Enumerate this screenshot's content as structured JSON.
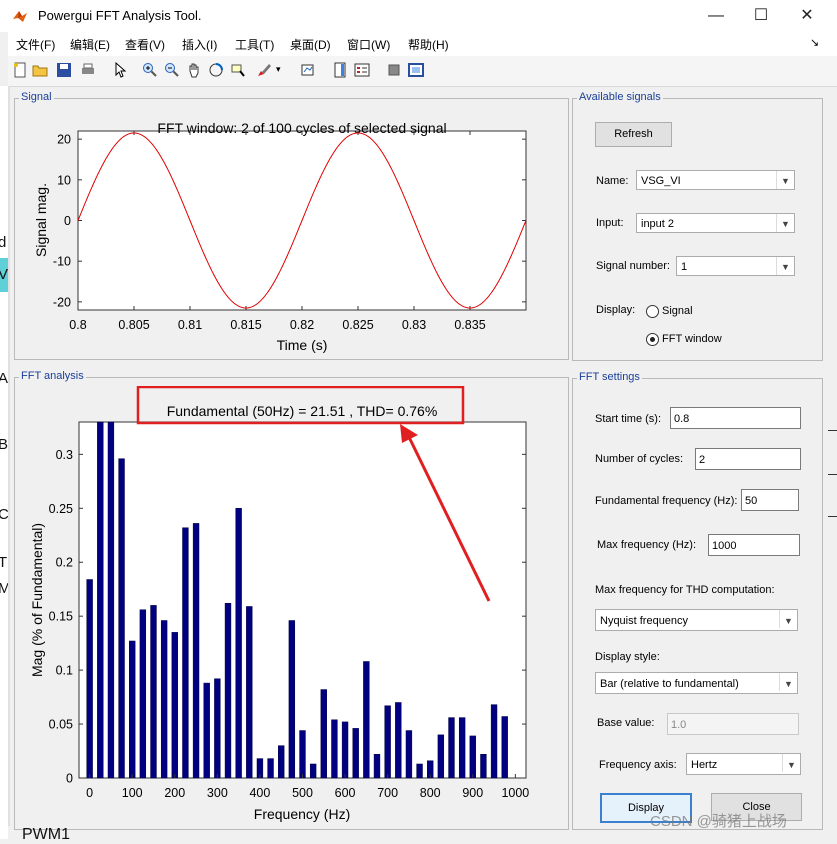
{
  "window": {
    "title": "Powergui FFT Analysis Tool."
  },
  "titlebar_buttons": {
    "minimize": "—",
    "maximize": "☐",
    "close": "✕"
  },
  "menu": [
    "文件(F)",
    "编辑(E)",
    "查看(V)",
    "插入(I)",
    "工具(T)",
    "桌面(D)",
    "窗口(W)",
    "帮助(H)"
  ],
  "signal_panel": {
    "title": "Signal",
    "plot_title": "FFT window: 2 of 100 cycles of selected signal",
    "xlabel": "Time (s)",
    "ylabel": "Signal mag.",
    "xticks": [
      "0.8",
      "0.805",
      "0.81",
      "0.815",
      "0.82",
      "0.825",
      "0.83",
      "0.835"
    ],
    "yticks": [
      "20",
      "10",
      "0",
      "-10",
      "-20"
    ]
  },
  "fft_panel": {
    "title": "FFT analysis",
    "annotation": "Fundamental (50Hz) = 21.51 , THD= 0.76%",
    "xlabel": "Frequency (Hz)",
    "ylabel": "Mag (% of Fundamental)",
    "xticks": [
      "0",
      "100",
      "200",
      "300",
      "400",
      "500",
      "600",
      "700",
      "800",
      "900",
      "1000"
    ],
    "yticks": [
      "0",
      "0.05",
      "0.1",
      "0.15",
      "0.2",
      "0.25",
      "0.3"
    ]
  },
  "available_signals": {
    "title": "Available signals",
    "refresh_label": "Refresh",
    "name_label": "Name:",
    "name_value": "VSG_VI",
    "input_label": "Input:",
    "input_value": "input 2",
    "signal_number_label": "Signal number:",
    "signal_number_value": "1",
    "display_label": "Display:",
    "display_signal": "Signal",
    "display_fft": "FFT window"
  },
  "fft_settings": {
    "title": "FFT settings",
    "start_time_label": "Start time (s):",
    "start_time": "0.8",
    "cycles_label": "Number of cycles:",
    "cycles": "2",
    "fund_freq_label": "Fundamental frequency (Hz):",
    "fund_freq": "50",
    "max_freq_label": "Max frequency (Hz):",
    "max_freq": "1000",
    "thd_label": "Max frequency for THD computation:",
    "thd_value": "Nyquist frequency",
    "display_style_label": "Display style:",
    "display_style": "Bar (relative to fundamental)",
    "base_value_label": "Base value:",
    "base_value": "1.0",
    "freq_axis_label": "Frequency axis:",
    "freq_axis": "Hertz",
    "display_button": "Display",
    "close_button": "Close"
  },
  "left_strip_chars": [
    "d",
    "V",
    "A",
    "B",
    "C",
    "T",
    "M"
  ],
  "bottom_left_text": "PWM1",
  "watermark": "CSDN @骑猪上战场",
  "colors": {
    "signal_line": "#e00000",
    "bar": "#000080",
    "annotation_box": "#e02020",
    "panel_title": "#1a3f9a"
  },
  "chart_data": [
    {
      "type": "line",
      "title": "FFT window: 2 of 100 cycles of selected signal",
      "xlabel": "Time (s)",
      "ylabel": "Signal mag.",
      "xlim": [
        0.8,
        0.84
      ],
      "ylim": [
        -22,
        22
      ],
      "series": [
        {
          "amplitude": 21.51,
          "frequency_hz": 50,
          "x_start": 0.8
        }
      ],
      "grid": false
    },
    {
      "type": "bar",
      "xlabel": "Frequency (Hz)",
      "ylabel": "Mag (% of Fundamental)",
      "xlim": [
        -25,
        1025
      ],
      "ylim": [
        0,
        0.33
      ],
      "x": [
        0,
        25,
        50,
        75,
        100,
        125,
        150,
        175,
        200,
        225,
        250,
        275,
        300,
        325,
        350,
        375,
        400,
        425,
        450,
        475,
        500,
        525,
        550,
        575,
        600,
        625,
        650,
        675,
        700,
        725,
        750,
        775,
        800,
        825,
        850,
        875,
        900,
        925,
        950,
        975,
        1000
      ],
      "values": [
        0.184,
        0.33,
        0.33,
        0.296,
        0.127,
        0.156,
        0.16,
        0.146,
        0.135,
        0.232,
        0.236,
        0.088,
        0.092,
        0.162,
        0.25,
        0.159,
        0.018,
        0.018,
        0.03,
        0.146,
        0.044,
        0.013,
        0.082,
        0.054,
        0.052,
        0.046,
        0.108,
        0.022,
        0.067,
        0.07,
        0.044,
        0.013,
        0.016,
        0.04,
        0.056,
        0.056,
        0.039,
        0.022,
        0.068,
        0.057,
        0.0
      ],
      "annotation": "Fundamental (50Hz) = 21.51 , THD= 0.76%"
    }
  ]
}
